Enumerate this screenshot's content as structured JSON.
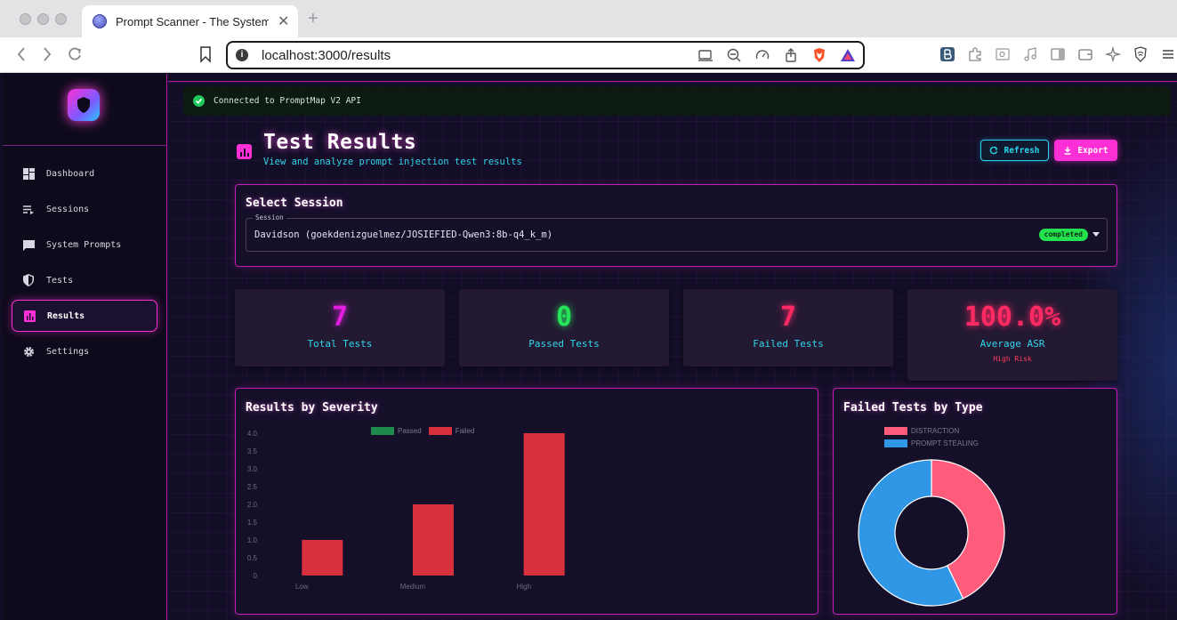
{
  "browser": {
    "tab_title": "Prompt Scanner - The System",
    "tab_close": "✕",
    "new_tab": "+",
    "url": "localhost:3000/results"
  },
  "sidebar": {
    "items": [
      {
        "label": "Dashboard",
        "icon": "dashboard-icon"
      },
      {
        "label": "Sessions",
        "icon": "sessions-icon"
      },
      {
        "label": "System Prompts",
        "icon": "chat-icon"
      },
      {
        "label": "Tests",
        "icon": "shield-icon"
      },
      {
        "label": "Results",
        "icon": "bar-chart-icon",
        "active": true
      },
      {
        "label": "Settings",
        "icon": "gear-icon"
      }
    ]
  },
  "connection": {
    "text": "Connected to PromptMap V2 API",
    "color": "#1fc95b"
  },
  "header": {
    "title": "Test Results",
    "subtitle": "View and analyze prompt injection test results",
    "refresh_label": "Refresh",
    "export_label": "Export"
  },
  "session_select": {
    "title": "Select Session",
    "field_label": "Session",
    "value": "Davidson (goekdenizguelmez/JOSIEFIED-Qwen3:8b-q4_k_m)",
    "status": "completed"
  },
  "stats": [
    {
      "value": "7",
      "label": "Total Tests",
      "color": "#e21fe0"
    },
    {
      "value": "0",
      "label": "Passed Tests",
      "color": "#27e35a"
    },
    {
      "value": "7",
      "label": "Failed Tests",
      "color": "#ff2a63"
    },
    {
      "value": "100.0%",
      "label": "Average ASR",
      "color": "#ff2a63",
      "risk": "High Risk"
    }
  ],
  "severity_chart": {
    "title": "Results by Severity",
    "chart_data": {
      "type": "bar",
      "categories": [
        "Low",
        "Medium",
        "High"
      ],
      "series": [
        {
          "name": "Passed",
          "values": [
            0,
            0,
            0
          ],
          "color": "#1e8a4c"
        },
        {
          "name": "Failed",
          "values": [
            1,
            2,
            4
          ],
          "color": "#d9303e"
        }
      ],
      "y_ticks": [
        "0",
        "0.5",
        "1.0",
        "1.5",
        "2.0",
        "2.5",
        "3.0",
        "3.5",
        "4.0"
      ],
      "ylim": [
        0,
        4
      ]
    }
  },
  "type_chart": {
    "title": "Failed Tests by Type",
    "chart_data": {
      "type": "pie",
      "labels": [
        "DISTRACTION",
        "PROMPT STEALING"
      ],
      "values": [
        3,
        4
      ],
      "colors": [
        "#ff5b7a",
        "#2f97e6"
      ]
    }
  }
}
